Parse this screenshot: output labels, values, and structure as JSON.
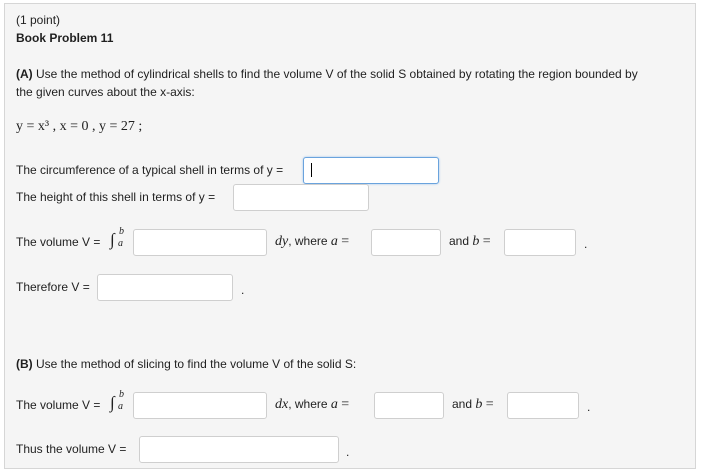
{
  "header": {
    "points": "(1 point)",
    "title": "Book Problem 11"
  },
  "partA": {
    "label": "(A)",
    "instruction_line1": " Use the method of cylindrical shells to find the volume V of the solid S obtained by rotating the region bounded by",
    "instruction_line2": "the given curves about the x-axis:",
    "curves": "y = x³ ,  x = 0 ,  y = 27 ;",
    "circumference_label": "The circumference of a typical shell in terms of y =",
    "circumference_value": "",
    "height_label": "The height of this shell in terms of y =",
    "height_value": "",
    "volume_label": "The volume V =",
    "integral_upper": "b",
    "integral_lower": "a",
    "differential": "dy",
    "where_a_text": ", where",
    "a_var": "a",
    "equals": "=",
    "and_text": "and",
    "b_var": "b",
    "integrand_value": "",
    "a_value": "",
    "b_value": "",
    "period": ".",
    "therefore_label": "Therefore V =",
    "therefore_value": ""
  },
  "partB": {
    "label": "(B)",
    "instruction": " Use the method of slicing to find the volume V of the solid S:",
    "volume_label": "The volume V =",
    "integral_upper": "b",
    "integral_lower": "a",
    "differential": "dx",
    "where_a_text": ", where",
    "a_var": "a",
    "equals": "=",
    "and_text": "and",
    "b_var": "b",
    "integrand_value": "",
    "a_value": "",
    "b_value": "",
    "period": ".",
    "thus_label": "Thus the volume V =",
    "thus_value": ""
  },
  "colors": {
    "panel_bg": "#f5f5f5",
    "panel_border": "#d6d6d6",
    "focus_border": "#6aa3dd"
  }
}
